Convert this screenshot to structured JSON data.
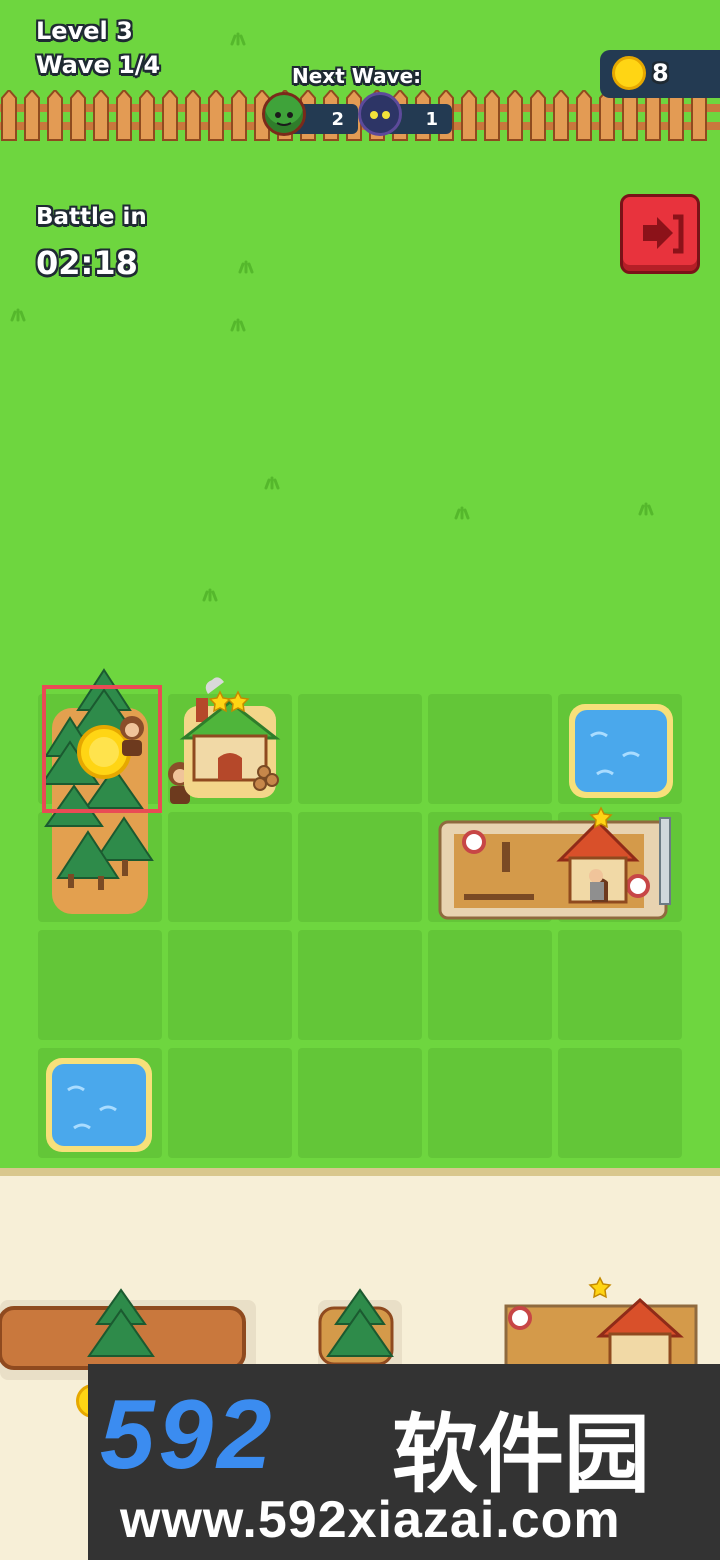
{
  "hud": {
    "level": "Level 3",
    "wave": "Wave 1/4",
    "next_wave_label": "Next Wave:",
    "enemies": [
      {
        "name": "goblin",
        "count": "2",
        "color": "#3fa33a"
      },
      {
        "name": "dark-imp",
        "count": "1",
        "color": "#2d3566"
      }
    ],
    "coins": "8"
  },
  "battle": {
    "label": "Battle in",
    "timer": "02:18"
  },
  "exit_button": {
    "icon": "exit-arrow-icon",
    "color": "#e8333d"
  },
  "board": {
    "pieces": [
      {
        "name": "forest",
        "stars": 0,
        "has_coin": true
      },
      {
        "name": "lumber-house",
        "stars": 2
      },
      {
        "name": "pond",
        "stars": 0
      },
      {
        "name": "archery-range",
        "stars": 1
      },
      {
        "name": "pond",
        "stars": 0
      }
    ]
  },
  "shop": {
    "items": [
      "log-platform",
      "pine-tree",
      "pine-tree",
      "archery-range"
    ],
    "archery_stars": 1
  },
  "watermark": {
    "logo": "592",
    "cn": "软件园",
    "url": "www.592xiazai.com"
  },
  "colors": {
    "grass": "#6ed63f",
    "tile": "#63c638",
    "highlight": "#e94b55",
    "coin": "#ffd514"
  }
}
